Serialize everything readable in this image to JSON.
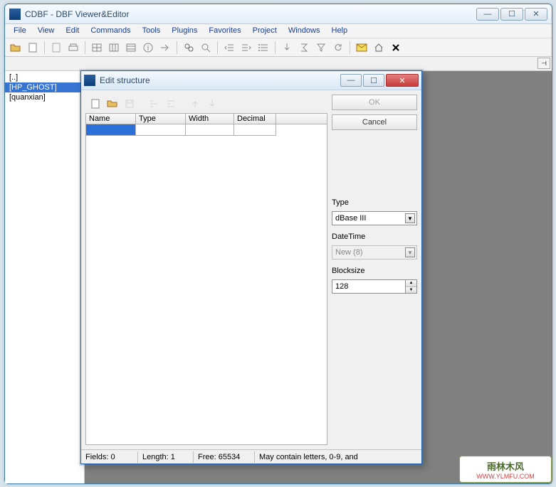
{
  "main": {
    "title": "CDBF - DBF Viewer&Editor",
    "menu": [
      "File",
      "View",
      "Edit",
      "Commands",
      "Tools",
      "Plugins",
      "Favorites",
      "Project",
      "Windows",
      "Help"
    ]
  },
  "sidebar": {
    "items": [
      "[..]",
      "[HP_GHOST]",
      "[quanxian]"
    ],
    "selected_index": 1
  },
  "dialog": {
    "title": "Edit structure",
    "buttons": {
      "ok": "OK",
      "cancel": "Cancel"
    },
    "columns": {
      "name": "Name",
      "type": "Type",
      "width": "Width",
      "decimal": "Decimal",
      "w_name": 70,
      "w_type": 70,
      "w_width": 68,
      "w_decimal": 59
    },
    "right": {
      "type_label": "Type",
      "type_value": "dBase III",
      "datetime_label": "DateTime",
      "datetime_value": "New (8)",
      "blocksize_label": "Blocksize",
      "blocksize_value": "128"
    },
    "status": {
      "fields": "Fields: 0",
      "length": "Length: 1",
      "free": "Free: 65534",
      "hint": "May contain letters, 0-9, and"
    }
  },
  "watermark": {
    "line1": "雨林木风",
    "line2": "WWW.YLMFU.COM"
  }
}
